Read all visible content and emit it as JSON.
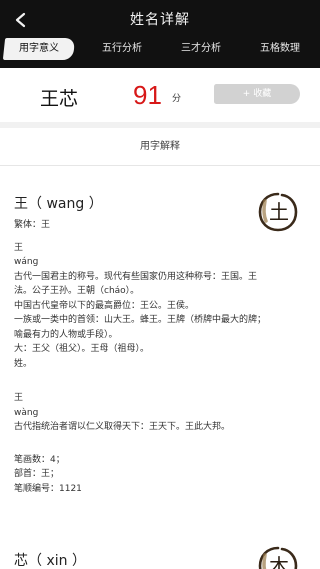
{
  "header": {
    "title": "姓名详解",
    "tabs": [
      "用字意义",
      "五行分析",
      "三才分析",
      "五格数理"
    ]
  },
  "name_row": {
    "name": "王芯",
    "score": "91",
    "score_unit": "分",
    "favorite_label": "+ 收藏"
  },
  "section": {
    "title": "用字解释"
  },
  "entries": [
    {
      "title": "王（ wang ）",
      "seal_char": "土",
      "lines": [
        "繁体：王",
        "",
        "王",
        "wáng",
        "古代一国君主的称号。现代有些国家仍用这种称号：王国。王",
        "法。公子王孙。王朝（cháo）。",
        "中国古代皇帝以下的最高爵位：王公。王侯。",
        "一族或一类中的首领：山大王。蜂王。王牌（桥牌中最大的牌；",
        "喻最有力的人物或手段）。",
        "大：王父（祖父）。王母（祖母）。",
        "姓。",
        "",
        "王",
        "wàng",
        "古代指统治者谓以仁义取得天下：王天下。王此大邦。",
        "",
        "笔画数：4；",
        "部首：王；",
        "笔顺编号：1121"
      ]
    },
    {
      "title": "芯（ xin ）",
      "seal_char": "木"
    }
  ]
}
